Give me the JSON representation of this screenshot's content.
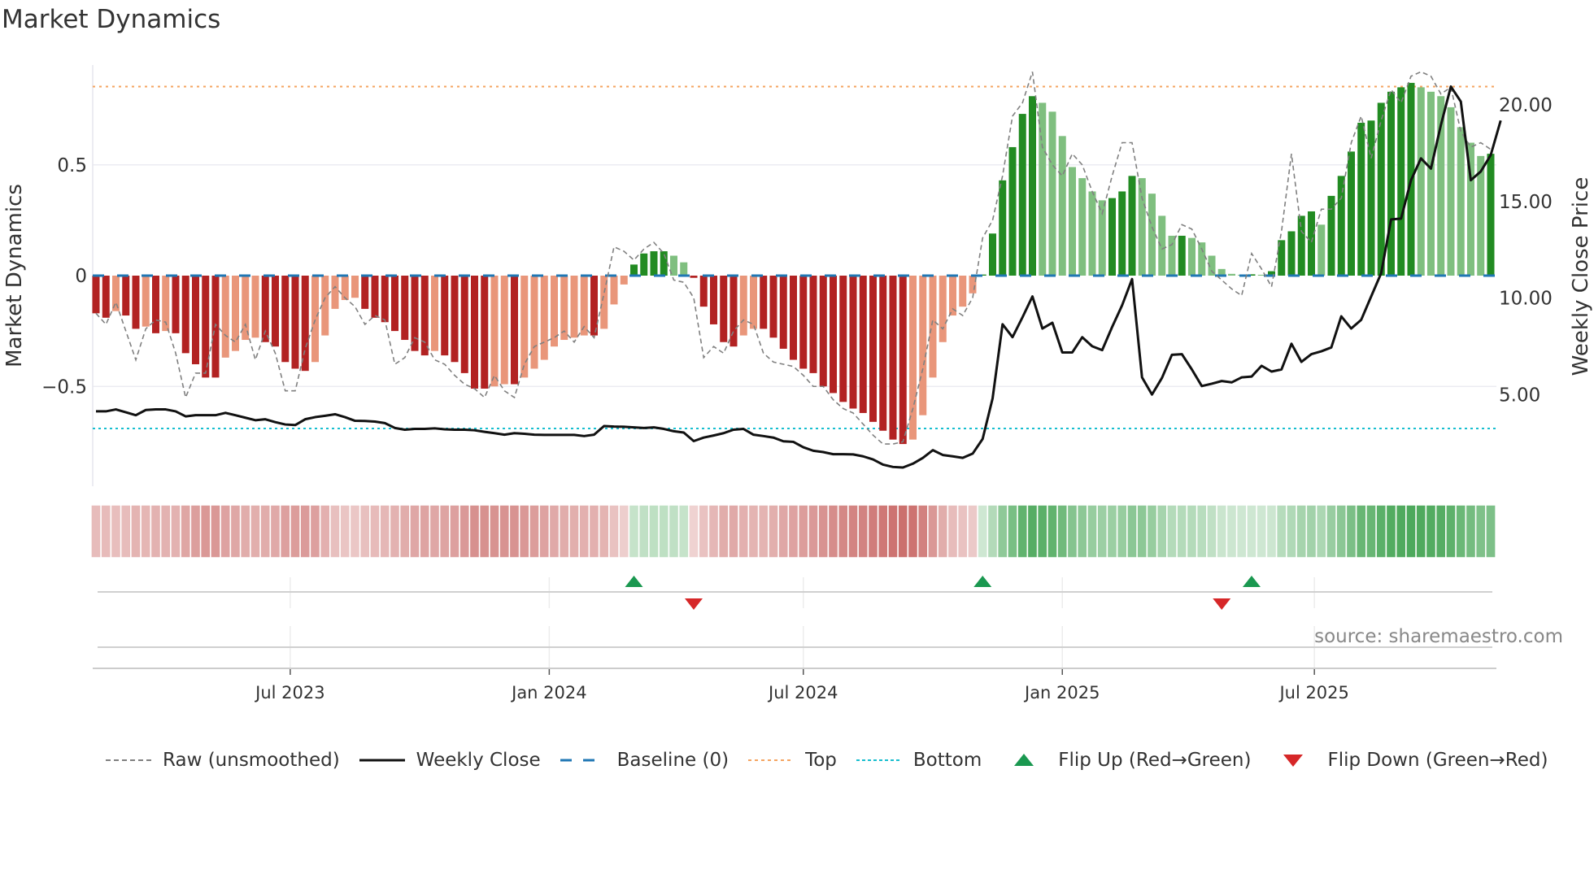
{
  "title": "Market Dynamics",
  "source": "source: sharemaestro.com",
  "legend": [
    {
      "key": "raw",
      "label": "Raw (unsmoothed)"
    },
    {
      "key": "close",
      "label": "Weekly Close"
    },
    {
      "key": "baseline",
      "label": "Baseline (0)"
    },
    {
      "key": "top",
      "label": "Top"
    },
    {
      "key": "bottom",
      "label": "Bottom"
    },
    {
      "key": "flipup",
      "label": "Flip Up (Red→Green)"
    },
    {
      "key": "flipdown",
      "label": "Flip Down (Green→Red)"
    }
  ],
  "colors": {
    "dark_green": "#228b22",
    "light_green": "#7fbf7f",
    "dark_red": "#b22222",
    "light_red": "#e9967a",
    "raw": "#808080",
    "close": "#111111",
    "baseline": "#1f77b4",
    "top": "#f4a460",
    "bottom": "#17becf",
    "flip_up": "#1a9850",
    "flip_down": "#d62728"
  },
  "chart_data": {
    "type": "bar",
    "title": "Market Dynamics",
    "ylabel": "Market Dynamics",
    "y2label": "Weekly Close Price",
    "ylim": [
      -0.95,
      0.95
    ],
    "y2lim": [
      0.2,
      22.4
    ],
    "yticks": [
      {
        "v": 0.5,
        "label": "0.5"
      },
      {
        "v": 0,
        "label": "0"
      },
      {
        "v": -0.5,
        "label": "−0.5"
      }
    ],
    "y2ticks": [
      {
        "v": 20,
        "label": "20.00"
      },
      {
        "v": 15,
        "label": "15.00"
      },
      {
        "v": 10,
        "label": "10.00"
      },
      {
        "v": 5,
        "label": "5.00"
      }
    ],
    "xticks": [
      {
        "week": 19.5,
        "label": "Jul 2023"
      },
      {
        "week": 45.5,
        "label": "Jan 2024"
      },
      {
        "week": 71,
        "label": "Jul 2024"
      },
      {
        "week": 97,
        "label": "Jan 2025"
      },
      {
        "week": 122.3,
        "label": "Jul 2025"
      }
    ],
    "top": 0.853,
    "bottom": -0.69,
    "baseline": 0,
    "values": [
      -0.17,
      -0.19,
      -0.16,
      -0.18,
      -0.24,
      -0.23,
      -0.26,
      -0.25,
      -0.26,
      -0.35,
      -0.4,
      -0.46,
      -0.46,
      -0.37,
      -0.34,
      -0.29,
      -0.28,
      -0.3,
      -0.32,
      -0.39,
      -0.42,
      -0.43,
      -0.39,
      -0.27,
      -0.15,
      -0.11,
      -0.1,
      -0.15,
      -0.19,
      -0.21,
      -0.25,
      -0.29,
      -0.34,
      -0.36,
      -0.34,
      -0.36,
      -0.39,
      -0.44,
      -0.51,
      -0.51,
      -0.5,
      -0.49,
      -0.49,
      -0.46,
      -0.42,
      -0.38,
      -0.32,
      -0.29,
      -0.28,
      -0.27,
      -0.27,
      -0.24,
      -0.13,
      -0.04,
      0.05,
      0.1,
      0.11,
      0.11,
      0.09,
      0.06,
      -0.01,
      -0.14,
      -0.22,
      -0.3,
      -0.32,
      -0.27,
      -0.24,
      -0.24,
      -0.28,
      -0.33,
      -0.38,
      -0.42,
      -0.44,
      -0.5,
      -0.53,
      -0.57,
      -0.6,
      -0.62,
      -0.66,
      -0.7,
      -0.74,
      -0.76,
      -0.74,
      -0.63,
      -0.46,
      -0.3,
      -0.18,
      -0.14,
      -0.08,
      0.005,
      0.19,
      0.43,
      0.58,
      0.73,
      0.81,
      0.78,
      0.74,
      0.63,
      0.49,
      0.44,
      0.38,
      0.34,
      0.35,
      0.38,
      0.45,
      0.44,
      0.37,
      0.27,
      0.18,
      0.18,
      0.17,
      0.15,
      0.09,
      0.03,
      0.008,
      0.004,
      0.006,
      0.004,
      0.02,
      0.16,
      0.2,
      0.27,
      0.29,
      0.23,
      0.36,
      0.45,
      0.56,
      0.69,
      0.7,
      0.78,
      0.83,
      0.85,
      0.87,
      0.85,
      0.83,
      0.81,
      0.76,
      0.67,
      0.6,
      0.54,
      0.55
    ],
    "raw": [
      -0.17,
      -0.22,
      -0.12,
      -0.25,
      -0.38,
      -0.24,
      -0.2,
      -0.21,
      -0.35,
      -0.55,
      -0.44,
      -0.44,
      -0.22,
      -0.27,
      -0.3,
      -0.22,
      -0.38,
      -0.25,
      -0.35,
      -0.52,
      -0.52,
      -0.33,
      -0.2,
      -0.1,
      -0.05,
      -0.1,
      -0.14,
      -0.22,
      -0.18,
      -0.2,
      -0.4,
      -0.37,
      -0.28,
      -0.3,
      -0.38,
      -0.4,
      -0.45,
      -0.49,
      -0.51,
      -0.55,
      -0.45,
      -0.52,
      -0.55,
      -0.4,
      -0.32,
      -0.3,
      -0.28,
      -0.25,
      -0.3,
      -0.23,
      -0.28,
      -0.08,
      0.13,
      0.11,
      0.07,
      0.12,
      0.15,
      0.1,
      -0.02,
      -0.03,
      -0.1,
      -0.37,
      -0.32,
      -0.35,
      -0.25,
      -0.2,
      -0.22,
      -0.35,
      -0.39,
      -0.4,
      -0.41,
      -0.45,
      -0.5,
      -0.5,
      -0.56,
      -0.6,
      -0.62,
      -0.67,
      -0.72,
      -0.76,
      -0.76,
      -0.75,
      -0.6,
      -0.42,
      -0.2,
      -0.24,
      -0.15,
      -0.18,
      -0.1,
      0.17,
      0.25,
      0.45,
      0.72,
      0.78,
      0.92,
      0.58,
      0.5,
      0.45,
      0.55,
      0.5,
      0.38,
      0.28,
      0.45,
      0.6,
      0.6,
      0.35,
      0.22,
      0.12,
      0.14,
      0.23,
      0.21,
      0.12,
      0.02,
      -0.02,
      -0.06,
      -0.09,
      0.1,
      0.03,
      -0.05,
      0.2,
      0.55,
      0.2,
      0.15,
      0.3,
      0.3,
      0.35,
      0.6,
      0.72,
      0.53,
      0.7,
      0.84,
      0.78,
      0.9,
      0.92,
      0.9,
      0.82,
      0.85,
      0.65,
      0.58,
      0.6,
      0.57
    ],
    "close": [
      4.13,
      4.13,
      4.23,
      4.08,
      3.93,
      4.2,
      4.23,
      4.23,
      4.13,
      3.87,
      3.93,
      3.93,
      3.93,
      4.05,
      3.93,
      3.8,
      3.67,
      3.72,
      3.57,
      3.45,
      3.42,
      3.72,
      3.83,
      3.9,
      3.98,
      3.83,
      3.64,
      3.63,
      3.6,
      3.52,
      3.27,
      3.18,
      3.22,
      3.22,
      3.25,
      3.2,
      3.18,
      3.18,
      3.15,
      3.07,
      3.0,
      2.92,
      3.0,
      2.97,
      2.92,
      2.91,
      2.91,
      2.91,
      2.91,
      2.85,
      2.92,
      3.37,
      3.34,
      3.33,
      3.3,
      3.27,
      3.3,
      3.22,
      3.1,
      3.03,
      2.59,
      2.77,
      2.88,
      3.0,
      3.18,
      3.22,
      2.92,
      2.85,
      2.77,
      2.58,
      2.55,
      2.27,
      2.09,
      2.02,
      1.91,
      1.91,
      1.9,
      1.8,
      1.64,
      1.37,
      1.25,
      1.22,
      1.42,
      1.72,
      2.12,
      1.87,
      1.8,
      1.72,
      1.94,
      2.7,
      4.8,
      8.64,
      7.97,
      9.0,
      10.08,
      8.42,
      8.72,
      7.18,
      7.18,
      7.97,
      7.5,
      7.3,
      8.5,
      9.62,
      10.98,
      5.89,
      5.0,
      5.86,
      7.06,
      7.09,
      6.3,
      5.44,
      5.56,
      5.7,
      5.63,
      5.89,
      5.93,
      6.49,
      6.19,
      6.3,
      7.63,
      6.69,
      7.09,
      7.24,
      7.44,
      9.05,
      8.42,
      8.87,
      10.08,
      11.28,
      14.07,
      14.11,
      16.1,
      17.23,
      16.7,
      18.96,
      20.95,
      20.17,
      16.1,
      16.55,
      17.4,
      19.19
    ],
    "flips": [
      {
        "week": 54,
        "dir": "up"
      },
      {
        "week": 60,
        "dir": "down"
      },
      {
        "week": 89,
        "dir": "up"
      },
      {
        "week": 113,
        "dir": "down"
      },
      {
        "week": 116,
        "dir": "up"
      }
    ]
  }
}
